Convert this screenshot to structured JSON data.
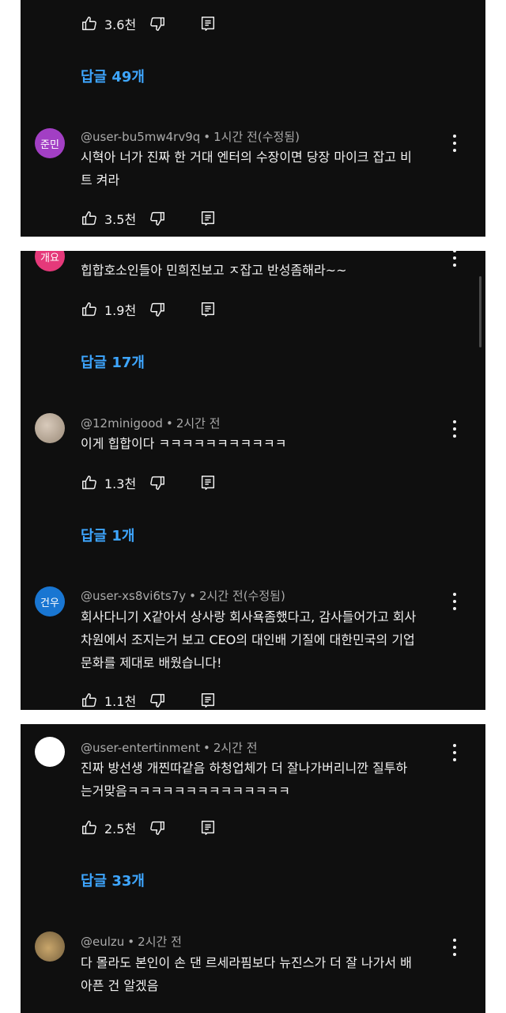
{
  "colors": {
    "background": "#0f0f0f",
    "reply_link": "#3ea6ff",
    "meta": "#aaaaaa",
    "separator": "#ffffff"
  },
  "icons": {
    "like": "thumb-up-icon",
    "dislike": "thumb-down-icon",
    "reply": "comment-icon",
    "more": "more-vert-icon"
  },
  "comments": [
    {
      "likes": "3.6천",
      "replies_label": "답글 49개"
    },
    {
      "avatar_text": "준민",
      "avatar_color": "#a23fc4",
      "author": "@user-bu5mw4rv9q",
      "time": "1시간 전(수정됨)",
      "lines": [
        "시혁아 너가 진짜 한 거대 엔터의 수장이면 당장 마이크 잡고 비",
        "트 켜라"
      ],
      "likes": "3.5천"
    },
    {
      "avatar_text": "개요",
      "avatar_color": "#e5397a",
      "lines": [
        "힙합호소인들아 민희진보고 ㅈ잡고 반성좀해라~~"
      ],
      "likes": "1.9천",
      "replies_label": "답글 17개"
    },
    {
      "avatar_color": "#b8a898",
      "author": "@12minigood",
      "time": "2시간 전",
      "lines": [
        "이게 힙합이다 ㅋㅋㅋㅋㅋㅋㅋㅋㅋㅋㅋ"
      ],
      "likes": "1.3천",
      "replies_label": "답글 1개"
    },
    {
      "avatar_text": "건우",
      "avatar_color": "#1976d2",
      "author": "@user-xs8vi6ts7y",
      "time": "2시간 전(수정됨)",
      "lines": [
        "회사다니기 X같아서 상사랑 회사욕좀했다고, 감사들어가고 회사",
        "차원에서 조지는거 보고 CEO의 대인배 기질에 대한민국의 기업",
        "문화를 제대로 배웠습니다!"
      ],
      "likes": "1.1천"
    },
    {
      "avatar_color": "#ffffff",
      "author": "@user-entertinment",
      "time": "2시간 전",
      "lines": [
        "진짜 방선생 개찐따같음 하청업체가 더 잘나가버리니깐 질투하",
        "는거맞음ㅋㅋㅋㅋㅋㅋㅋㅋㅋㅋㅋㅋㅋㅋ"
      ],
      "likes": "2.5천",
      "replies_label": "답글 33개"
    },
    {
      "avatar_color": "#8a7a5a",
      "author": "@eulzu",
      "time": "2시간 전",
      "lines": [
        "다 몰라도 본인이 손 댄 르세라핌보다 뉴진스가 더 잘 나가서 배",
        "아픈 건 알겠음"
      ]
    }
  ]
}
